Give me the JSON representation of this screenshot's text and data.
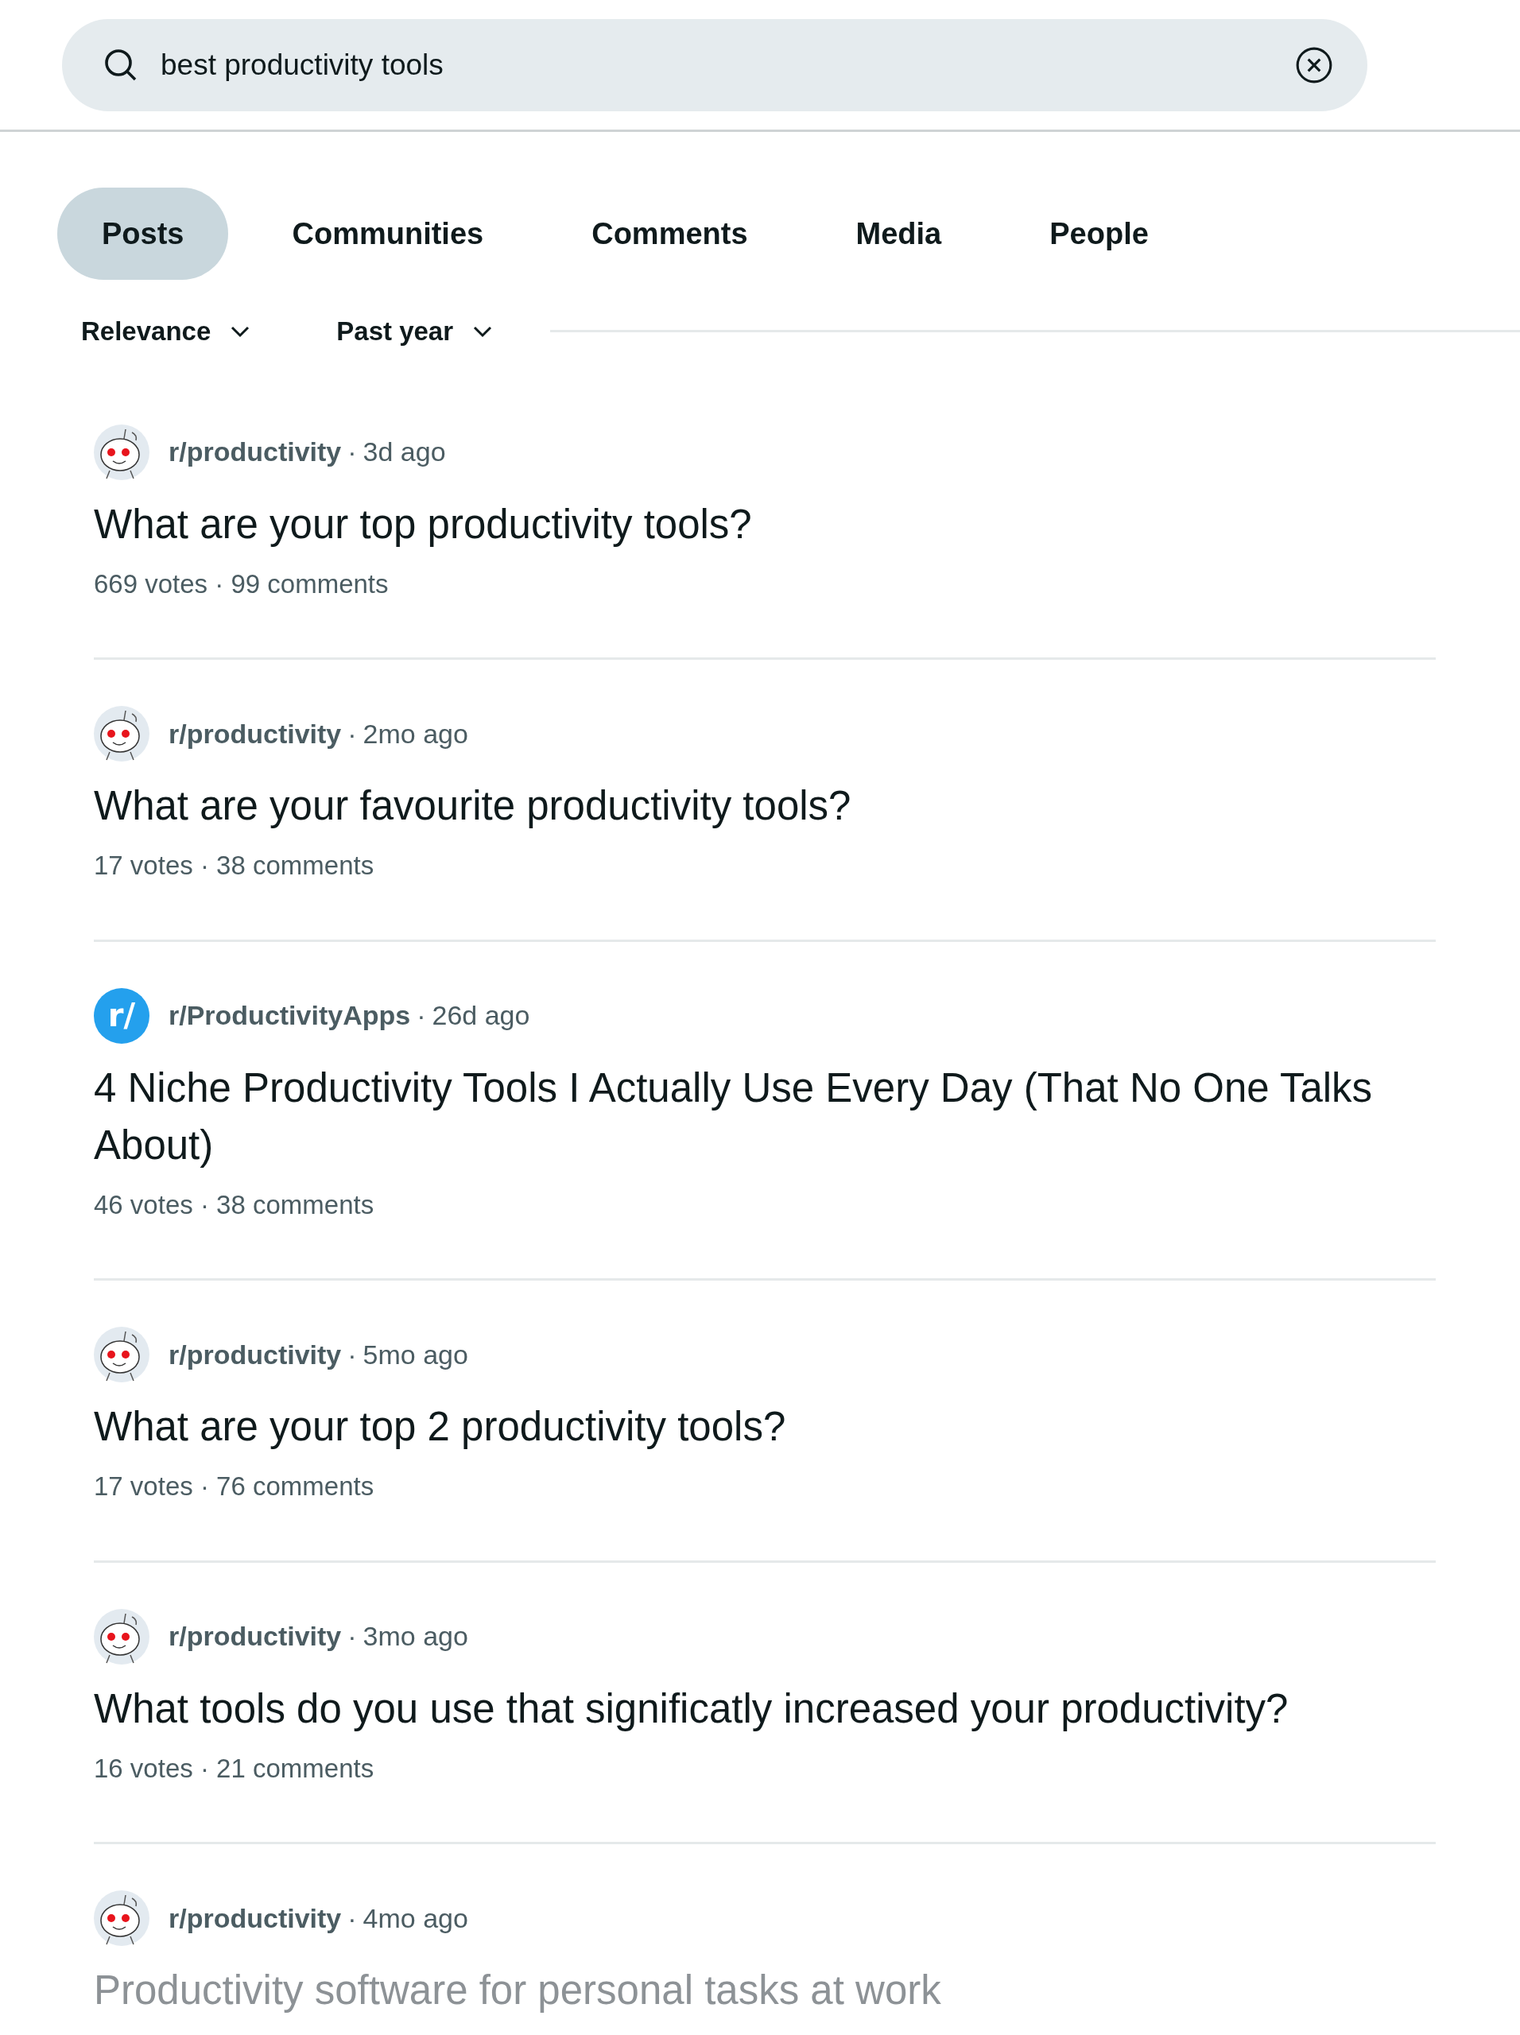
{
  "search": {
    "value": "best productivity tools"
  },
  "tabs": [
    {
      "label": "Posts",
      "selected": true
    },
    {
      "label": "Communities",
      "selected": false
    },
    {
      "label": "Comments",
      "selected": false
    },
    {
      "label": "Media",
      "selected": false
    },
    {
      "label": "People",
      "selected": false
    }
  ],
  "filters": [
    {
      "label": "Relevance"
    },
    {
      "label": "Past year"
    }
  ],
  "posts": [
    {
      "kind": "snoo",
      "community": "r/productivity",
      "separator": "·",
      "age": "3d ago",
      "title": "What are your top productivity tools?",
      "stats": "669 votes · 99 comments",
      "faded": false
    },
    {
      "kind": "snoo",
      "community": "r/productivity",
      "separator": "·",
      "age": "2mo ago",
      "title": "What are your favourite productivity tools?",
      "stats": "17 votes · 38 comments",
      "faded": false
    },
    {
      "kind": "letter",
      "avatar_text": "r/",
      "community": "r/ProductivityApps",
      "separator": "·",
      "age": "26d ago",
      "title": "4 Niche Productivity Tools I Actually Use Every Day (That No One Talks About)",
      "stats": "46 votes · 38 comments",
      "faded": false
    },
    {
      "kind": "snoo",
      "community": "r/productivity",
      "separator": "·",
      "age": "5mo ago",
      "title": "What are your top 2 productivity tools?",
      "stats": "17 votes · 76 comments",
      "faded": false
    },
    {
      "kind": "snoo",
      "community": "r/productivity",
      "separator": "·",
      "age": "3mo ago",
      "title": "What tools do you use that significatly increased your productivity?",
      "stats": "16 votes · 21 comments",
      "faded": false
    },
    {
      "kind": "snoo",
      "community": "r/productivity",
      "separator": "·",
      "age": "4mo ago",
      "title": "Productivity software for personal tasks at work",
      "faded": true
    }
  ]
}
